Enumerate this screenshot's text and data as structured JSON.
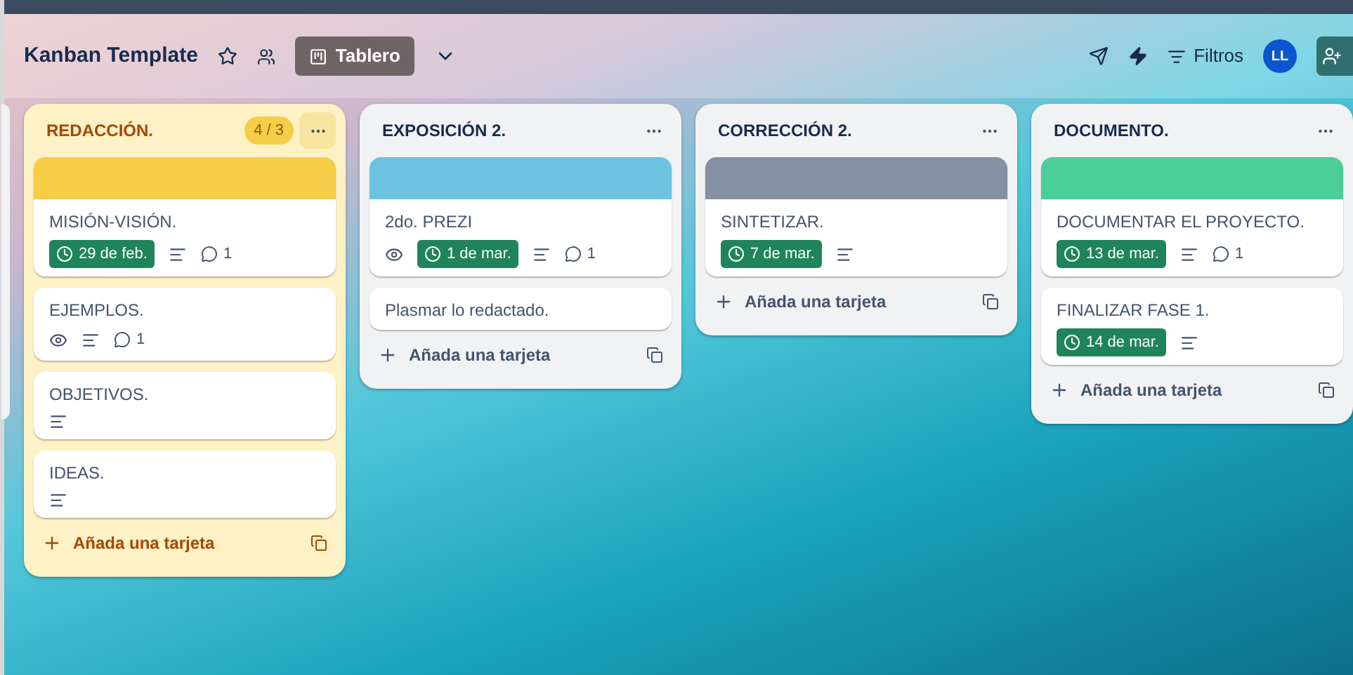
{
  "header": {
    "title": "Kanban Template",
    "view_button": "Tablero",
    "filters": "Filtros",
    "avatar": "LL"
  },
  "lists": [
    {
      "title": "REDACCIÓN.",
      "color": "#fdf1c6",
      "count": "4 / 3",
      "cover": {
        "color": "#f5cd47"
      },
      "add_label": "Añada una tarjeta",
      "cards": [
        {
          "title": "MISIÓN-VISIÓN.",
          "watching": false,
          "due": "29 de feb.",
          "description": true,
          "comments": "1"
        },
        {
          "title": "EJEMPLOS.",
          "watching": true,
          "description": true,
          "comments": "1"
        },
        {
          "title": "OBJETIVOS.",
          "watching": false,
          "description": true
        },
        {
          "title": "IDEAS.",
          "watching": false,
          "description": true
        }
      ]
    },
    {
      "title": "EXPOSICIÓN 2.",
      "color": "#f1f2f4",
      "cover": {
        "color": "#6cc3e0"
      },
      "add_label": "Añada una tarjeta",
      "cards": [
        {
          "title": "2do. PREZI",
          "watching": true,
          "due": "1 de mar.",
          "description": true,
          "comments": "1"
        },
        {
          "title": "Plasmar lo redactado.",
          "watching": false,
          "description": false
        }
      ]
    },
    {
      "title": "CORRECCIÓN 2.",
      "color": "#f1f2f4",
      "cover": {
        "color": "#8590a2"
      },
      "add_label": "Añada una tarjeta",
      "cards": [
        {
          "title": "SINTETIZAR.",
          "watching": false,
          "due": "7 de mar.",
          "description": true
        }
      ]
    },
    {
      "title": "DOCUMENTO.",
      "color": "#f1f2f4",
      "cover": {
        "color": "#4bce97"
      },
      "add_label": "Añada una tarjeta",
      "cards": [
        {
          "title": "DOCUMENTAR EL PROYECTO.",
          "watching": false,
          "due": "13 de mar.",
          "description": true,
          "comments": "1"
        },
        {
          "title": "FINALIZAR FASE 1.",
          "watching": false,
          "due": "14 de mar.",
          "description": true
        }
      ]
    }
  ]
}
